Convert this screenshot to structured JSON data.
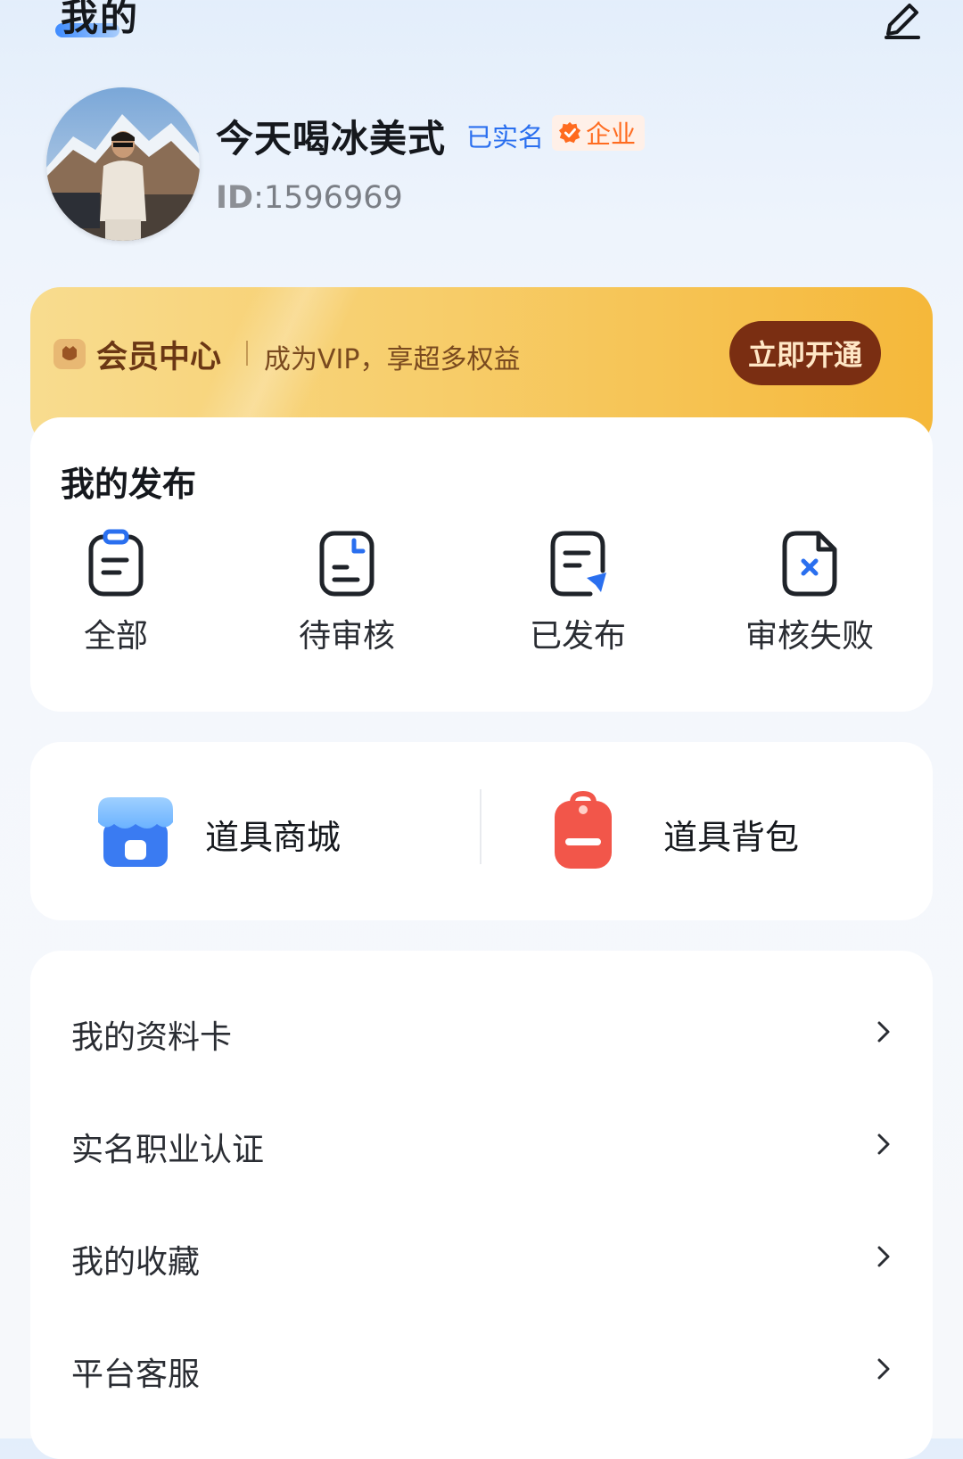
{
  "header": {
    "title": "我的",
    "edit_icon": "edit-icon"
  },
  "profile": {
    "name": "今天喝冰美式",
    "verified_badge": "已实名",
    "enterprise_badge": "企业",
    "id_label": "ID",
    "id_value": ":1596969"
  },
  "vip": {
    "title": "会员中心",
    "description": "成为VIP，享超多权益",
    "button_label": "立即开通"
  },
  "publish": {
    "title": "我的发布",
    "items": [
      {
        "label": "全部",
        "icon": "all-posts-icon"
      },
      {
        "label": "待审核",
        "icon": "pending-review-icon"
      },
      {
        "label": "已发布",
        "icon": "published-icon"
      },
      {
        "label": "审核失败",
        "icon": "review-failed-icon"
      }
    ]
  },
  "tools": {
    "items": [
      {
        "label": "道具商城",
        "icon": "shop-icon"
      },
      {
        "label": "道具背包",
        "icon": "backpack-icon"
      }
    ]
  },
  "menu": {
    "items": [
      {
        "label": "我的资料卡"
      },
      {
        "label": "实名职业认证"
      },
      {
        "label": "我的收藏"
      },
      {
        "label": "平台客服"
      }
    ]
  },
  "colors": {
    "accent_blue": "#2a6fef",
    "enterprise_orange": "#ff6b1f",
    "vip_button": "#7a2e12",
    "backpack_red": "#f2564a",
    "shop_blue": "#3a7bf2"
  }
}
